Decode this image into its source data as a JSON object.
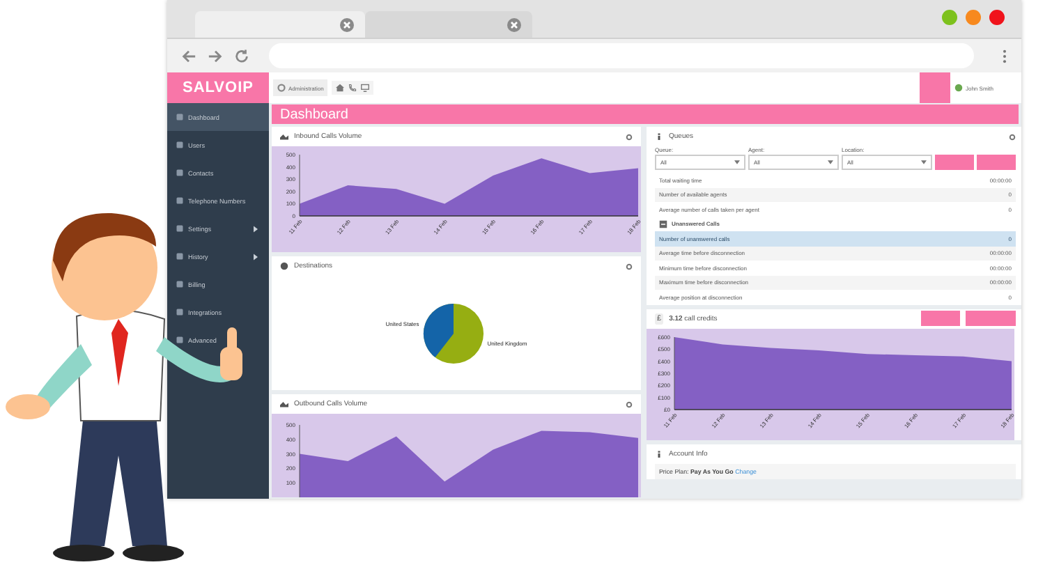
{
  "browser": {
    "tabs": [
      {
        "selected": true
      },
      {
        "selected": false
      }
    ]
  },
  "app": {
    "logo": "SALVOIP",
    "breadcrumb": "Administration",
    "user": "John Smith",
    "sidebar": [
      {
        "label": "Dashboard",
        "selected": true,
        "submenu": false
      },
      {
        "label": "Users",
        "selected": false,
        "submenu": false
      },
      {
        "label": "Contacts",
        "selected": false,
        "submenu": false
      },
      {
        "label": "Telephone Numbers",
        "selected": false,
        "submenu": false
      },
      {
        "label": "Settings",
        "selected": false,
        "submenu": true
      },
      {
        "label": "History",
        "selected": false,
        "submenu": true
      },
      {
        "label": "Billing",
        "selected": false,
        "submenu": false
      },
      {
        "label": "Integrations",
        "selected": false,
        "submenu": false
      },
      {
        "label": "Advanced",
        "selected": false,
        "submenu": false
      }
    ]
  },
  "page_title": "Dashboard",
  "inbound": {
    "title": "Inbound Calls Volume",
    "chart_data": {
      "type": "area",
      "categories": [
        "11 Feb",
        "12 Feb",
        "13 Feb",
        "14 Feb",
        "15 Feb",
        "16 Feb",
        "17 Feb",
        "18 Feb"
      ],
      "series": [
        {
          "color": "#8460c4",
          "values": [
            100,
            250,
            220,
            100,
            330,
            470,
            350,
            390
          ]
        }
      ],
      "ylim": [
        0,
        500
      ],
      "yticks": [
        0,
        100,
        200,
        300,
        400,
        500
      ]
    }
  },
  "destinations": {
    "title": "Destinations",
    "pie_labels": [
      "United States",
      "United Kingdom"
    ]
  },
  "outbound": {
    "title": "Outbound Calls Volume",
    "chart_data": {
      "type": "area",
      "series": [
        {
          "color": "#8460c4",
          "values": [
            300,
            250,
            420,
            110,
            330,
            460,
            450,
            410
          ]
        }
      ],
      "ylim": [
        0,
        500
      ],
      "yticks": [
        100,
        200,
        300,
        400,
        500
      ]
    }
  },
  "queues": {
    "title": "Queues",
    "filters": [
      {
        "label": "Queue:",
        "value": "All"
      },
      {
        "label": "Agent:",
        "value": "All"
      },
      {
        "label": "Location:",
        "value": "All"
      }
    ],
    "rows": [
      {
        "kind": "row",
        "label": "Total waiting time",
        "value": "00:00:00",
        "selected": false
      },
      {
        "kind": "row",
        "label": "Number of available agents",
        "value": "0",
        "selected": false
      },
      {
        "kind": "row",
        "label": "Average number of calls taken per agent",
        "value": "0",
        "selected": false
      },
      {
        "kind": "section",
        "label": "Unanswered Calls",
        "selected": false
      },
      {
        "kind": "row",
        "label": "Number of unanswered calls",
        "value": "0",
        "selected": true
      },
      {
        "kind": "row",
        "label": "Average time before disconnection",
        "value": "00:00:00",
        "selected": false
      },
      {
        "kind": "row",
        "label": "Minimum time before disconnection",
        "value": "00:00:00",
        "selected": false
      },
      {
        "kind": "row",
        "label": "Maximum time before disconnection",
        "value": "00:00:00",
        "selected": false
      },
      {
        "kind": "row",
        "label": "Average position at disconnection",
        "value": "0",
        "selected": false
      }
    ]
  },
  "credits": {
    "symbol": "£",
    "amount": "3.12",
    "label": "call credits",
    "chart_data": {
      "type": "area",
      "categories": [
        "11 Feb",
        "12 Feb",
        "13 Feb",
        "14 Feb",
        "15 Feb",
        "16 Feb",
        "17 Feb",
        "18 Feb"
      ],
      "series": [
        {
          "color": "#8460c4",
          "values": [
            600,
            540,
            510,
            490,
            460,
            450,
            440,
            400
          ]
        }
      ],
      "ylim": [
        0,
        600
      ],
      "yticks": [
        {
          "value": 0,
          "label": "£0"
        },
        {
          "value": 100,
          "label": "£100"
        },
        {
          "value": 200,
          "label": "£200"
        },
        {
          "value": 300,
          "label": "£300"
        },
        {
          "value": 400,
          "label": "£400"
        },
        {
          "value": 500,
          "label": "£500"
        },
        {
          "value": 600,
          "label": "£600"
        }
      ]
    }
  },
  "account": {
    "title": "Account Info",
    "plan": "Price Plan: **Pay As You Go**",
    "link": "Change"
  }
}
